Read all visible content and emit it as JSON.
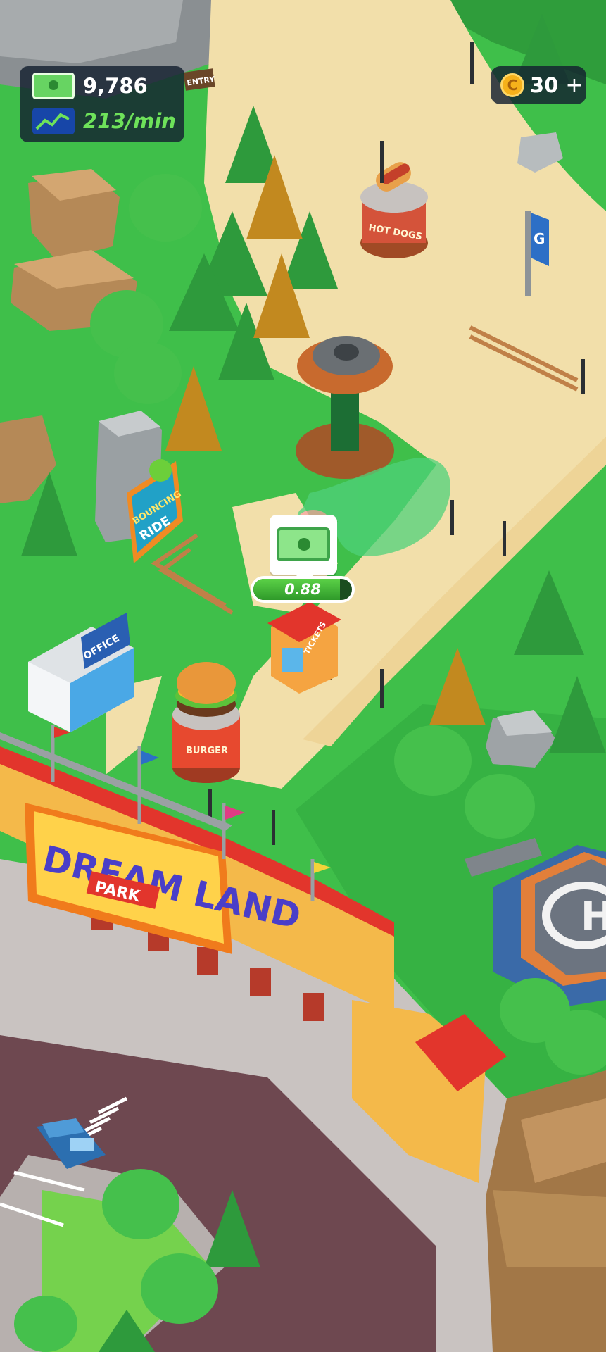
{
  "hud": {
    "cash": "9,786",
    "income_rate": "213/min",
    "coins": "30",
    "coin_add": "+"
  },
  "park": {
    "name_line1": "DREAM LAND",
    "name_line2": "PARK",
    "office_sign": "OFFICE",
    "tickets_sign": "TICKETS",
    "burger_sign": "BURGER",
    "hotdog_sign": "HOT DOGS",
    "entry_sign": "ENTRY",
    "ride_sign_line1": "BOUNCING",
    "ride_sign_line2": "RIDE"
  },
  "booth": {
    "timer_value": "0.88",
    "timer_progress": 0.88
  },
  "colors": {
    "cash_text": "#ffffff",
    "rate_text": "#6ee25a",
    "grass": "#3fbf4a",
    "path": "#f2dfaa",
    "gate_red": "#e2352c",
    "gate_orange": "#f07b1c"
  }
}
